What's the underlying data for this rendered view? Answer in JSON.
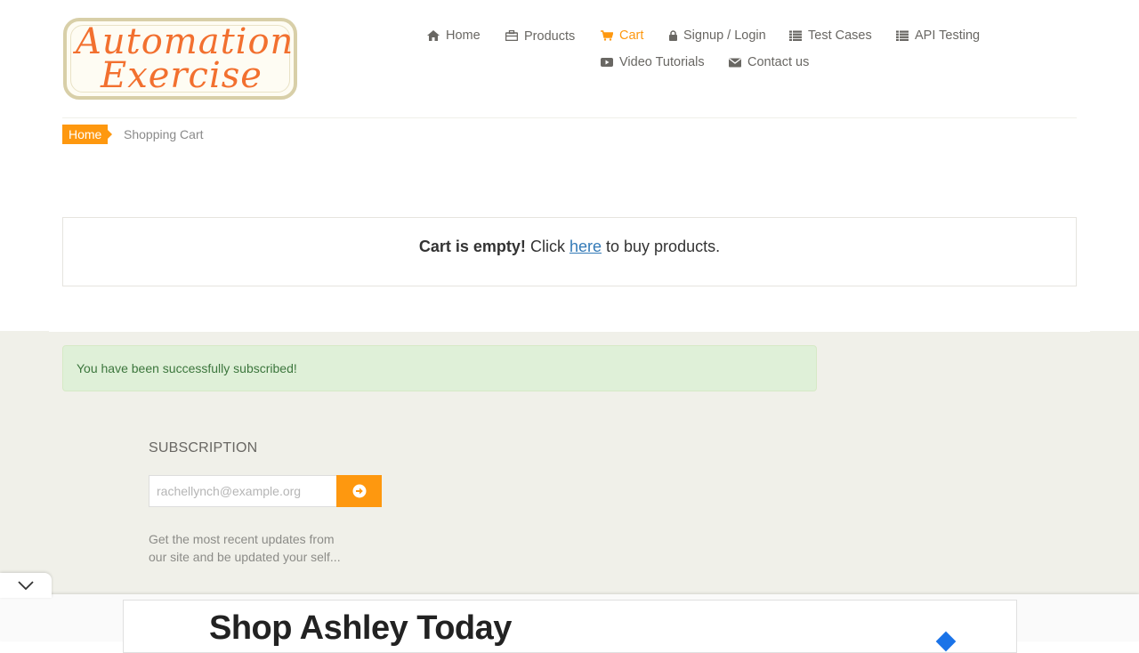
{
  "logo": {
    "line1": "Automation",
    "line2": "Exercise"
  },
  "nav": {
    "home": "Home",
    "products": "Products",
    "cart": "Cart",
    "signup_login": "Signup / Login",
    "test_cases": "Test Cases",
    "api_testing": "API Testing",
    "video_tutorials": "Video Tutorials",
    "contact_us": "Contact us"
  },
  "breadcrumb": {
    "home": "Home",
    "current": "Shopping Cart"
  },
  "cart": {
    "empty_bold": "Cart is empty!",
    "click": "Click",
    "link": "here",
    "suffix": "to buy products."
  },
  "footer": {
    "alert": "You have been successfully subscribed!",
    "subscription_title": "SUBSCRIPTION",
    "email_value": "rachellynch@example.org",
    "description": "Get the most recent updates from our site and be updated your self..."
  },
  "ad": {
    "headline": "Shop Ashley Today"
  },
  "colors": {
    "accent": "#fe980f",
    "link": "#337ab7",
    "alert_bg": "#dff0d8",
    "footer_bg": "#f0f0e9"
  },
  "icons": [
    "home-icon",
    "briefcase-icon",
    "cart-icon",
    "lock-icon",
    "list-icon",
    "youtube-icon",
    "envelope-icon",
    "arrow-circle-right-icon",
    "chevron-down-icon"
  ]
}
